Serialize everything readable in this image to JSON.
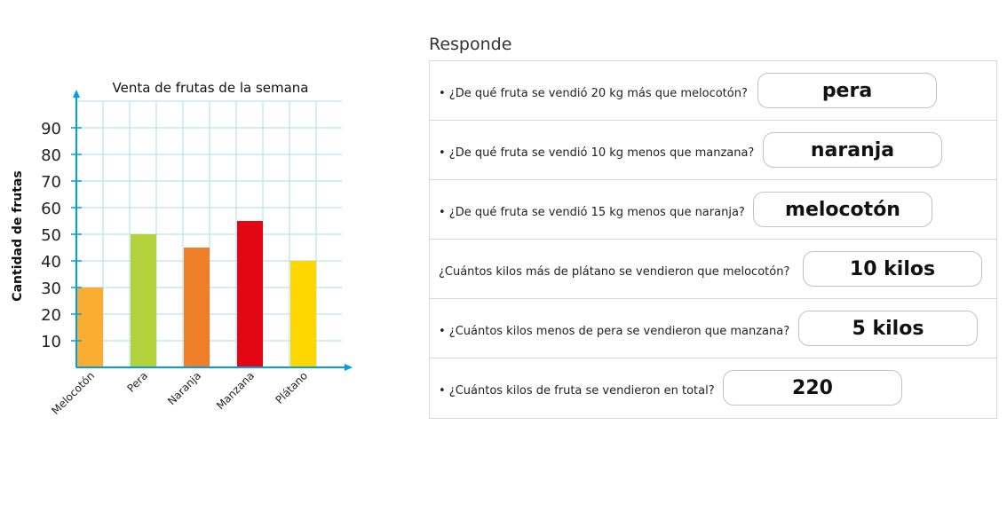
{
  "chart_data": {
    "type": "bar",
    "title": "Venta de frutas de la semana",
    "ylabel": "Cantidad de frutas",
    "xlabel": "",
    "categories": [
      "Melocotón",
      "Pera",
      "Naranja",
      "Manzana",
      "Plátano"
    ],
    "values": [
      30,
      50,
      45,
      55,
      40
    ],
    "colors": [
      "#f9ad33",
      "#b3d13a",
      "#ee7f28",
      "#e30613",
      "#fed700"
    ],
    "ylim": [
      0,
      100
    ],
    "yticks": [
      10,
      20,
      30,
      40,
      50,
      60,
      70,
      80,
      90
    ],
    "grid": true,
    "grid_color": "#a8dcef",
    "axis_color": "#009fe3"
  },
  "responde": {
    "title": "Responde",
    "questions": [
      {
        "text": "• ¿De qué fruta se vendió 20 kg más que melocotón?",
        "answer": "pera"
      },
      {
        "text": "• ¿De qué fruta se vendió 10 kg menos que manzana?",
        "answer": "naranja"
      },
      {
        "text": "• ¿De qué fruta se vendió 15 kg menos que naranja?",
        "answer": "melocotón"
      },
      {
        "text": "¿Cuántos kilos más de plátano se vendieron que melocotón?",
        "answer": "10 kilos"
      },
      {
        "text": "• ¿Cuántos kilos menos de pera se vendieron que manzana?",
        "answer": "5 kilos"
      },
      {
        "text": "• ¿Cuántos kilos de fruta se vendieron en total?",
        "answer": "220"
      }
    ]
  }
}
